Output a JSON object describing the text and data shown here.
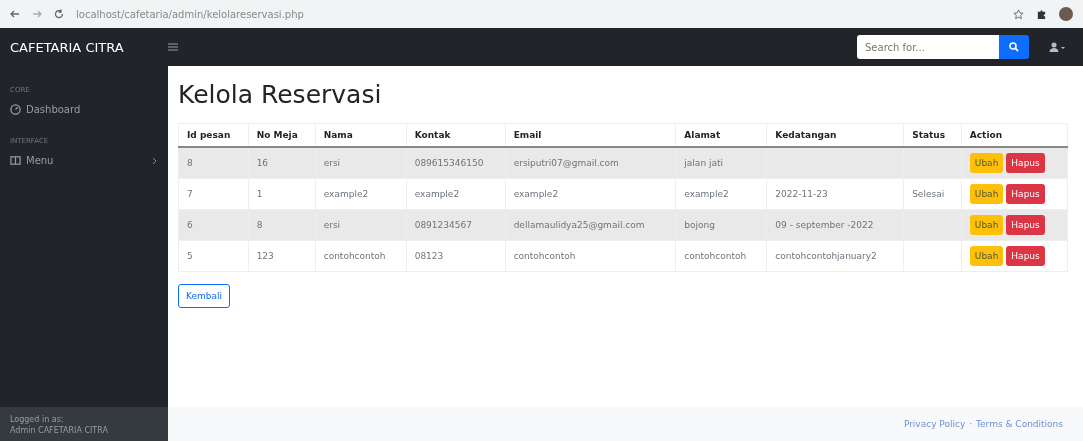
{
  "browser": {
    "url": "localhost/cafetaria/admin/kelolareservasi.php"
  },
  "navbar": {
    "brand": "CAFETARIA CITRA",
    "search": {
      "placeholder": "Search for..."
    }
  },
  "sidebar": {
    "sections": [
      {
        "heading": "CORE",
        "items": [
          {
            "label": "Dashboard",
            "kind": "gauge"
          }
        ]
      },
      {
        "heading": "INTERFACE",
        "items": [
          {
            "label": "Menu",
            "kind": "columns",
            "expanded": false
          }
        ]
      }
    ],
    "footer": {
      "label": "Logged in as:",
      "user": "Admin CAFETARIA CITRA"
    }
  },
  "page": {
    "title": "Kelola Reservasi",
    "table": {
      "columns": [
        "Id pesan",
        "No Meja",
        "Nama",
        "Kontak",
        "Email",
        "Alamat",
        "Kedatangan",
        "Status",
        "Action"
      ],
      "rows": [
        {
          "cells": [
            "8",
            "16",
            "ersi",
            "089615346150",
            "ersiputri07@gmail.com",
            "jalan jati",
            "",
            ""
          ],
          "actions": [
            {
              "label": "Ubah",
              "kind": "warning"
            },
            {
              "label": "Hapus",
              "kind": "danger"
            }
          ]
        },
        {
          "cells": [
            "7",
            "1",
            "example2",
            "example2",
            "example2",
            "example2",
            "2022-11-23",
            "Selesai"
          ],
          "actions": [
            {
              "label": "Ubah",
              "kind": "warning"
            },
            {
              "label": "Hapus",
              "kind": "danger"
            }
          ]
        },
        {
          "cells": [
            "6",
            "8",
            "ersi",
            "0891234567",
            "dellamaulidya25@gmail.com",
            "bojong",
            "09 - september -2022",
            ""
          ],
          "actions": [
            {
              "label": "Ubah",
              "kind": "warning"
            },
            {
              "label": "Hapus",
              "kind": "danger"
            }
          ]
        },
        {
          "cells": [
            "5",
            "123",
            "contohcontoh",
            "08123",
            "contohcontoh",
            "contohcontoh",
            "contohcontohjanuary2",
            ""
          ],
          "actions": [
            {
              "label": "Ubah",
              "kind": "warning"
            },
            {
              "label": "Hapus",
              "kind": "danger"
            }
          ]
        }
      ]
    },
    "back_button": "Kembali",
    "footer_links": [
      "Privacy Policy",
      "·",
      "Terms & Conditions"
    ]
  }
}
